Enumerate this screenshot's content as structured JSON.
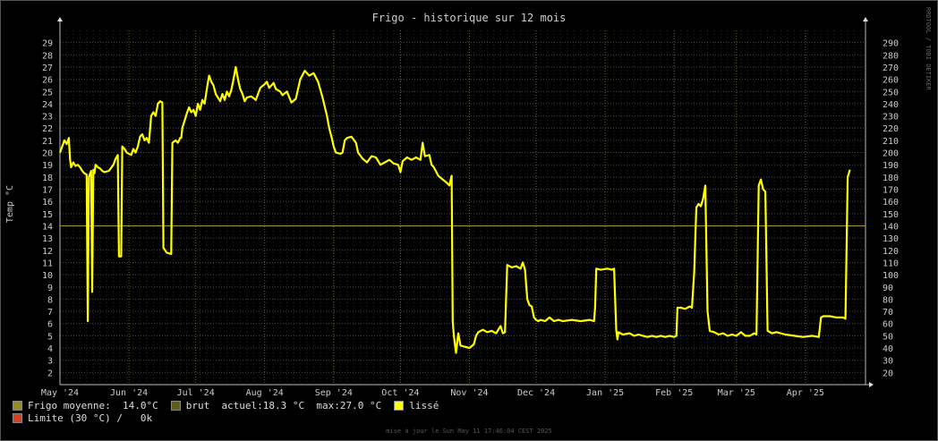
{
  "chart_data": {
    "type": "line",
    "title": "Frigo - historique sur 12 mois",
    "ylabel": "Temp °C",
    "ylim": [
      1,
      30
    ],
    "y_ticks": [
      2,
      3,
      4,
      5,
      6,
      7,
      8,
      9,
      10,
      11,
      12,
      13,
      14,
      15,
      16,
      17,
      18,
      19,
      20,
      21,
      22,
      23,
      24,
      25,
      26,
      27,
      28,
      29
    ],
    "y2_ticks": [
      20,
      30,
      40,
      50,
      60,
      70,
      80,
      90,
      100,
      110,
      120,
      130,
      140,
      150,
      160,
      170,
      180,
      190,
      200,
      210,
      220,
      230,
      240,
      250,
      260,
      270,
      280,
      290
    ],
    "x_ticks": [
      "May '24",
      "Jun '24",
      "Jul '24",
      "Aug '24",
      "Sep '24",
      "Oct '24",
      "Nov '24",
      "Dec '24",
      "Jan '25",
      "Feb '25",
      "Mar '25",
      "Apr '25"
    ],
    "xlim_days": [
      0,
      362
    ],
    "grid": true,
    "reference_line": 14.0,
    "series": [
      {
        "name": "lissé",
        "color": "#ffff00",
        "points": [
          [
            0,
            20
          ],
          [
            1,
            20.5
          ],
          [
            2,
            21
          ],
          [
            3,
            20.7
          ],
          [
            4,
            21.2
          ],
          [
            4.5,
            19.5
          ],
          [
            5,
            18.8
          ],
          [
            6,
            19.2
          ],
          [
            7,
            18.9
          ],
          [
            8,
            19
          ],
          [
            9,
            18.8
          ],
          [
            10,
            18.5
          ],
          [
            11,
            18.3
          ],
          [
            12,
            18.2
          ],
          [
            12.5,
            6.2
          ],
          [
            13,
            18
          ],
          [
            14,
            18.5
          ],
          [
            14.5,
            8.6
          ],
          [
            15,
            18.6
          ],
          [
            15.5,
            18.3
          ],
          [
            16,
            19
          ],
          [
            17,
            18.8
          ],
          [
            18,
            18.7
          ],
          [
            19,
            18.5
          ],
          [
            20,
            18.4
          ],
          [
            22,
            18.5
          ],
          [
            24,
            19
          ],
          [
            25,
            19.5
          ],
          [
            26,
            19.8
          ],
          [
            26.5,
            11.5
          ],
          [
            27.5,
            11.5
          ],
          [
            28,
            20.5
          ],
          [
            29,
            20.3
          ],
          [
            30,
            20
          ],
          [
            32,
            19.8
          ],
          [
            33,
            20.3
          ],
          [
            34,
            20
          ],
          [
            35,
            20.5
          ],
          [
            36,
            21.3
          ],
          [
            37,
            21.5
          ],
          [
            38,
            21
          ],
          [
            39,
            21.2
          ],
          [
            40,
            20.8
          ],
          [
            41,
            23
          ],
          [
            42,
            23.3
          ],
          [
            43,
            23
          ],
          [
            44,
            24
          ],
          [
            45,
            24.2
          ],
          [
            46,
            24.1
          ],
          [
            46.5,
            12.2
          ],
          [
            48,
            11.8
          ],
          [
            50,
            11.7
          ],
          [
            50.5,
            20.8
          ],
          [
            52,
            21
          ],
          [
            53,
            20.8
          ],
          [
            54,
            21.2
          ],
          [
            54.5,
            21.2
          ],
          [
            55,
            22
          ],
          [
            56,
            22.6
          ],
          [
            57,
            23.2
          ],
          [
            58,
            23.7
          ],
          [
            59,
            23.3
          ],
          [
            60,
            23.5
          ],
          [
            61,
            23
          ],
          [
            62,
            24
          ],
          [
            63,
            23.5
          ],
          [
            64,
            24.3
          ],
          [
            65,
            24
          ],
          [
            66,
            25.2
          ],
          [
            67,
            26.3
          ],
          [
            68,
            25.8
          ],
          [
            69,
            25.5
          ],
          [
            70,
            24.8
          ],
          [
            71,
            24.5
          ],
          [
            72,
            24.2
          ],
          [
            73,
            24.8
          ],
          [
            74,
            24.3
          ],
          [
            75,
            25
          ],
          [
            76,
            24.6
          ],
          [
            77,
            25.1
          ],
          [
            78,
            26
          ],
          [
            79,
            27
          ],
          [
            80,
            26
          ],
          [
            81,
            25.2
          ],
          [
            82,
            24.8
          ],
          [
            83,
            24.2
          ],
          [
            84,
            24.5
          ],
          [
            86,
            24.6
          ],
          [
            88,
            24.3
          ],
          [
            90,
            25.3
          ],
          [
            92,
            25.6
          ],
          [
            93,
            25.8
          ],
          [
            94,
            25.3
          ],
          [
            96,
            25.7
          ],
          [
            97,
            25.2
          ],
          [
            99,
            25
          ],
          [
            100,
            24.7
          ],
          [
            102,
            25
          ],
          [
            104,
            24.1
          ],
          [
            106,
            24.4
          ],
          [
            107,
            25.2
          ],
          [
            108,
            26
          ],
          [
            110,
            26.7
          ],
          [
            112,
            26.3
          ],
          [
            114,
            26.5
          ],
          [
            116,
            25.8
          ],
          [
            118,
            24.5
          ],
          [
            120,
            23
          ],
          [
            121,
            22
          ],
          [
            122,
            21.3
          ],
          [
            123,
            20.5
          ],
          [
            124,
            20
          ],
          [
            126,
            19.9
          ],
          [
            127,
            20
          ],
          [
            128,
            21
          ],
          [
            129,
            21.2
          ],
          [
            131,
            21.3
          ],
          [
            133,
            20.8
          ],
          [
            134,
            20
          ],
          [
            136,
            19.5
          ],
          [
            138,
            19.2
          ],
          [
            140,
            19.7
          ],
          [
            142,
            19.6
          ],
          [
            144,
            19
          ],
          [
            146,
            19.2
          ],
          [
            148,
            19.4
          ],
          [
            150,
            19.1
          ],
          [
            152,
            19
          ],
          [
            153,
            18.4
          ],
          [
            154,
            19.3
          ],
          [
            156,
            19.6
          ],
          [
            158,
            19.4
          ],
          [
            160,
            19.6
          ],
          [
            162,
            19.4
          ],
          [
            163,
            20.8
          ],
          [
            164,
            19.7
          ],
          [
            166,
            19.8
          ],
          [
            167,
            19
          ],
          [
            168,
            18.8
          ],
          [
            170,
            18.1
          ],
          [
            172,
            17.8
          ],
          [
            174,
            17.5
          ],
          [
            175,
            17.3
          ],
          [
            176,
            18.1
          ],
          [
            176.5,
            6.2
          ],
          [
            177,
            5
          ],
          [
            178,
            3.6
          ],
          [
            179,
            5.2
          ],
          [
            180,
            4.2
          ],
          [
            182,
            4.1
          ],
          [
            184,
            4
          ],
          [
            186,
            4.3
          ],
          [
            187,
            5
          ],
          [
            188,
            5.3
          ],
          [
            190,
            5.5
          ],
          [
            192,
            5.3
          ],
          [
            194,
            5.4
          ],
          [
            196,
            5.2
          ],
          [
            198,
            5.8
          ],
          [
            199,
            5.2
          ],
          [
            200,
            5.3
          ],
          [
            201,
            10.8
          ],
          [
            203,
            10.6
          ],
          [
            205,
            10.7
          ],
          [
            207,
            10.5
          ],
          [
            208,
            11
          ],
          [
            209,
            10.4
          ],
          [
            210,
            8
          ],
          [
            211,
            7.5
          ],
          [
            212,
            7.4
          ],
          [
            213,
            6.5
          ],
          [
            214,
            6.3
          ],
          [
            215,
            6.2
          ],
          [
            216,
            6.3
          ],
          [
            218,
            6.2
          ],
          [
            220,
            6.5
          ],
          [
            222,
            6.2
          ],
          [
            224,
            6.3
          ],
          [
            226,
            6.2
          ],
          [
            230,
            6.3
          ],
          [
            234,
            6.2
          ],
          [
            238,
            6.3
          ],
          [
            240,
            6.2
          ],
          [
            240.5,
            7.3
          ],
          [
            241,
            10.5
          ],
          [
            243,
            10.4
          ],
          [
            246,
            10.5
          ],
          [
            248,
            10.4
          ],
          [
            249,
            10.5
          ],
          [
            250,
            5.5
          ],
          [
            250.5,
            4.7
          ],
          [
            251,
            5.3
          ],
          [
            253,
            5.1
          ],
          [
            256,
            5.2
          ],
          [
            258,
            5
          ],
          [
            260,
            5.1
          ],
          [
            262,
            5
          ],
          [
            264,
            4.9
          ],
          [
            266,
            5
          ],
          [
            268,
            4.9
          ],
          [
            270,
            5
          ],
          [
            272,
            4.9
          ],
          [
            274,
            5
          ],
          [
            276,
            4.9
          ],
          [
            277,
            5
          ],
          [
            277.5,
            7.3
          ],
          [
            279,
            7.3
          ],
          [
            281,
            7.2
          ],
          [
            283,
            7.4
          ],
          [
            284,
            7.3
          ],
          [
            285,
            10.2
          ],
          [
            286,
            15.5
          ],
          [
            287,
            15.8
          ],
          [
            288,
            15.6
          ],
          [
            289,
            16.2
          ],
          [
            290,
            17.3
          ],
          [
            291,
            7
          ],
          [
            292,
            5.4
          ],
          [
            294,
            5.3
          ],
          [
            296,
            5.1
          ],
          [
            298,
            5.2
          ],
          [
            300,
            5
          ],
          [
            302,
            5.1
          ],
          [
            304,
            5
          ],
          [
            306,
            5.3
          ],
          [
            308,
            5
          ],
          [
            310,
            5
          ],
          [
            312,
            5.2
          ],
          [
            313,
            5.1
          ],
          [
            314,
            17.3
          ],
          [
            315,
            17.8
          ],
          [
            316,
            17
          ],
          [
            317,
            16.8
          ],
          [
            318,
            5.4
          ],
          [
            320,
            5.2
          ],
          [
            322,
            5.3
          ],
          [
            326,
            5.1
          ],
          [
            330,
            5
          ],
          [
            334,
            4.9
          ],
          [
            338,
            5
          ],
          [
            341,
            4.9
          ],
          [
            342,
            6.5
          ],
          [
            343,
            6.6
          ],
          [
            346,
            6.6
          ],
          [
            349,
            6.5
          ],
          [
            352,
            6.5
          ],
          [
            353,
            6.4
          ],
          [
            354,
            18
          ],
          [
            355,
            18.6
          ]
        ]
      }
    ],
    "legend": {
      "avg_label": "Frigo moyenne:  14.0°C",
      "raw_label": "brut  actuel:18.3 °C  max:27.0 °C",
      "smooth_label": "lissé",
      "limit_label": "Limite (30 °C) /   0k",
      "colors": {
        "avg": "#998a1f",
        "raw": "#5e5d1a",
        "smooth": "#ffff00",
        "limit": "#d94020"
      }
    },
    "footer": "mise à jour le Sun May 11 17:46:04 CEST 2025",
    "watermark": "RRDTOOL / TOBI OETIKER",
    "reference_color": "#a89a2a"
  }
}
